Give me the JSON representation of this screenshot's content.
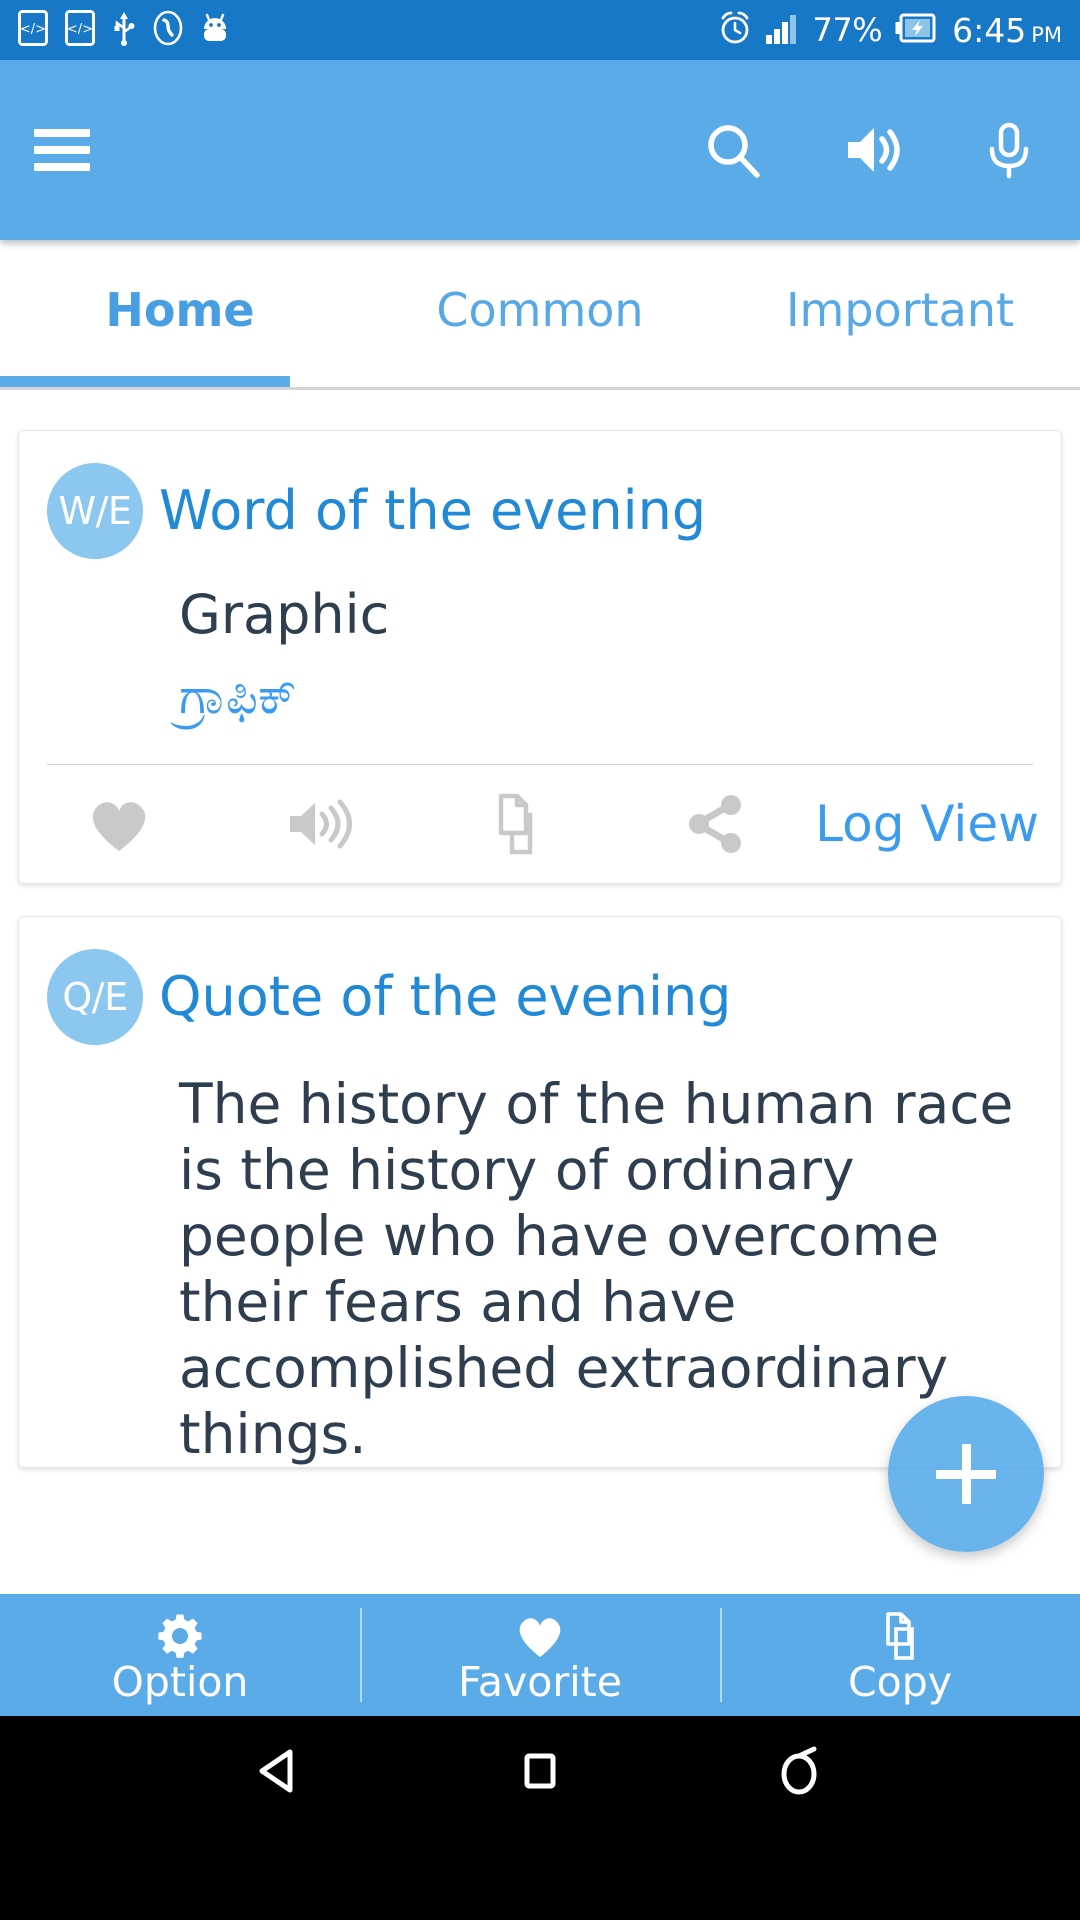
{
  "status_bar": {
    "battery_percent": "77%",
    "time": "6:45",
    "meridiem": "PM",
    "icons": [
      "dev-mode-icon",
      "dev-mode-icon-2",
      "usb-icon",
      "phone-icon",
      "android-robot-icon",
      "alarm-icon",
      "signal-icon",
      "battery-charging-icon"
    ],
    "background_color": "#1878c8"
  },
  "app_bar": {
    "menu_icon": "hamburger-menu-icon",
    "actions": [
      {
        "name": "search-icon",
        "label": "Search"
      },
      {
        "name": "speaker-icon",
        "label": "Speak"
      },
      {
        "name": "microphone-icon",
        "label": "Voice search"
      }
    ],
    "background_color": "#5aabe8"
  },
  "tabs": {
    "items": [
      {
        "label": "Home",
        "active": true
      },
      {
        "label": "Common",
        "active": false
      },
      {
        "label": "Important",
        "active": false
      }
    ],
    "indicator_color": "#5aabe8"
  },
  "cards": {
    "word": {
      "avatar": "W/E",
      "title": "Word of the evening",
      "word_english": "Graphic",
      "word_translation": "ಗ್ರಾಫಿಕ್",
      "actions": [
        {
          "name": "favorite-heart-icon",
          "label": "Favorite"
        },
        {
          "name": "speaker-icon",
          "label": "Pronounce"
        },
        {
          "name": "copy-icon",
          "label": "Copy"
        },
        {
          "name": "share-icon",
          "label": "Share"
        }
      ],
      "log_view_label": "Log View"
    },
    "quote": {
      "avatar": "Q/E",
      "title": "Quote of the evening",
      "text": "The history of the human race is the history of ordinary people who have overcome their fears and have accomplished extraordinary things."
    }
  },
  "fab": {
    "name": "add-button",
    "glyph": "+",
    "color": "#54aae9"
  },
  "bottom_bar": {
    "items": [
      {
        "label": "Option",
        "icon": "gear-icon"
      },
      {
        "label": "Favorite",
        "icon": "heart-icon"
      },
      {
        "label": "Copy",
        "icon": "copy-icon"
      }
    ],
    "background_color": "#5aabe8"
  },
  "nav_bar": {
    "items": [
      {
        "label": "Back",
        "icon": "back-triangle-icon"
      },
      {
        "label": "Home",
        "icon": "home-square-icon"
      },
      {
        "label": "Recents",
        "icon": "recents-circle-icon"
      }
    ]
  }
}
